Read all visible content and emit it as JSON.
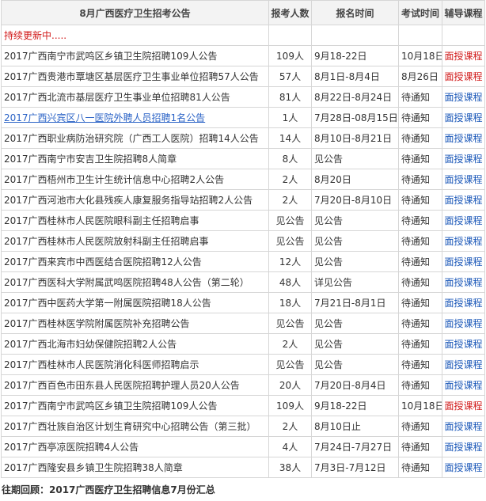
{
  "headers": {
    "title": "8月广西医疗卫生招考公告",
    "count": "报考人数",
    "reg": "报名时间",
    "exam": "考试时间",
    "course": "辅导课程"
  },
  "notice": "持续更新中.....",
  "rows": [
    {
      "title": "2017广西南宁市武鸣区乡镇卫生院招聘109人公告",
      "count": "109人",
      "reg": "9月18-22日",
      "exam": "10月18日",
      "course": "面授课程",
      "course_color": "red",
      "link": false
    },
    {
      "title": "2017广西贵港市覃塘区基层医疗卫生事业单位招聘57人公告",
      "count": "57人",
      "reg": "8月1日-8月4日",
      "exam": "8月26日",
      "course": "面授课程",
      "course_color": "red",
      "link": false
    },
    {
      "title": "2017广西北流市基层医疗卫生事业单位招聘81人公告",
      "count": "81人",
      "reg": "8月22日-8月24日",
      "exam": "待通知",
      "course": "面授课程",
      "course_color": "blue",
      "link": false
    },
    {
      "title": "2017广西兴宾区八一医院外聘人员招聘1名公告",
      "count": "1人",
      "reg": "7月28日-08月15日",
      "exam": "待通知",
      "course": "面授课程",
      "course_color": "blue",
      "link": true
    },
    {
      "title": "2017广西职业病防治研究院（广西工人医院）招聘14人公告",
      "count": "14人",
      "reg": "8月10日-8月21日",
      "exam": "待通知",
      "course": "面授课程",
      "course_color": "blue",
      "link": false
    },
    {
      "title": "2017广西南宁市安吉卫生院招聘8人简章",
      "count": "8人",
      "reg": "见公告",
      "exam": "待通知",
      "course": "面授课程",
      "course_color": "blue",
      "link": false
    },
    {
      "title": "2017广西梧州市卫生计生统计信息中心招聘2人公告",
      "count": "2人",
      "reg": "8月20日",
      "exam": "待通知",
      "course": "面授课程",
      "course_color": "blue",
      "link": false
    },
    {
      "title": "2017广西河池市大化县残疾人康复服务指导站招聘2人公告",
      "count": "2人",
      "reg": "7月20日-8月10日",
      "exam": "待通知",
      "course": "面授课程",
      "course_color": "blue",
      "link": false
    },
    {
      "title": "2017广西桂林市人民医院眼科副主任招聘启事",
      "count": "见公告",
      "reg": "见公告",
      "exam": "待通知",
      "course": "面授课程",
      "course_color": "blue",
      "link": false
    },
    {
      "title": "2017广西桂林市人民医院放射科副主任招聘启事",
      "count": "见公告",
      "reg": "见公告",
      "exam": "待通知",
      "course": "面授课程",
      "course_color": "blue",
      "link": false
    },
    {
      "title": "2017广西来宾市中西医结合医院招聘12人公告",
      "count": "12人",
      "reg": "见公告",
      "exam": "待通知",
      "course": "面授课程",
      "course_color": "blue",
      "link": false
    },
    {
      "title": "2017广西医科大学附属武鸣医院招聘48人公告（第二轮）",
      "count": "48人",
      "reg": "详见公告",
      "exam": "待通知",
      "course": "面授课程",
      "course_color": "blue",
      "link": false
    },
    {
      "title": "2017广西中医药大学第一附属医院招聘18人公告",
      "count": "18人",
      "reg": "7月21日-8月1日",
      "exam": "待通知",
      "course": "面授课程",
      "course_color": "blue",
      "link": false
    },
    {
      "title": "2017广西桂林医学院附属医院补充招聘公告",
      "count": "见公告",
      "reg": "见公告",
      "exam": "待通知",
      "course": "面授课程",
      "course_color": "blue",
      "link": false
    },
    {
      "title": "2017广西北海市妇幼保健院招聘2人公告",
      "count": "2人",
      "reg": "见公告",
      "exam": "待通知",
      "course": "面授课程",
      "course_color": "blue",
      "link": false
    },
    {
      "title": "2017广西桂林市人民医院消化科医师招聘启示",
      "count": "见公告",
      "reg": "见公告",
      "exam": "待通知",
      "course": "面授课程",
      "course_color": "blue",
      "link": false
    },
    {
      "title": "2017广西百色市田东县人民医院招聘护理人员20人公告",
      "count": "20人",
      "reg": "7月20日-8月4日",
      "exam": "待通知",
      "course": "面授课程",
      "course_color": "blue",
      "link": false
    },
    {
      "title": "2017广西南宁市武鸣区乡镇卫生院招聘109人公告",
      "count": "109人",
      "reg": "9月18-22日",
      "exam": "10月18日",
      "course": "面授课程",
      "course_color": "red",
      "link": false
    },
    {
      "title": "2017广西壮族自治区计划生育研究中心招聘公告（第三批）",
      "count": "2人",
      "reg": "8月10日止",
      "exam": "待通知",
      "course": "面授课程",
      "course_color": "blue",
      "link": false
    },
    {
      "title": "2017广西亭凉医院招聘4人公告",
      "count": "4人",
      "reg": "7月24日-7月27日",
      "exam": "待通知",
      "course": "面授课程",
      "course_color": "blue",
      "link": false
    },
    {
      "title": " 2017广西隆安县乡镇卫生院招聘38人简章",
      "count": "38人",
      "reg": "7月3日-7月12日",
      "exam": "待通知",
      "course": "面授课程",
      "course_color": "blue",
      "link": false
    }
  ],
  "footer": "往期回顾：2017广西医疗卫生招聘信息7月份汇总"
}
